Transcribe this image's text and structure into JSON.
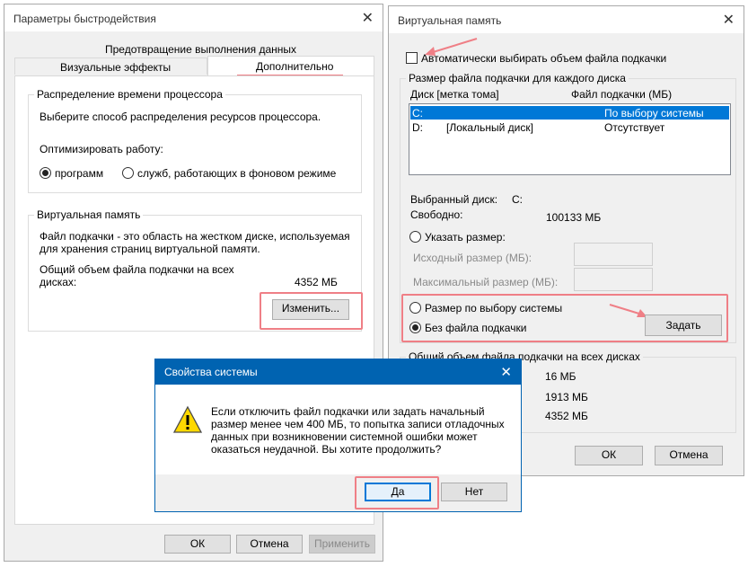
{
  "perf": {
    "title": "Параметры быстродействия",
    "tabs": [
      "Предотвращение выполнения данных",
      "Визуальные эффекты",
      "Дополнительно"
    ],
    "cpu": {
      "group": "Распределение времени процессора",
      "desc": "Выберите способ распределения ресурсов процессора.",
      "optimize": "Оптимизировать работу:",
      "opt_programs": "программ",
      "opt_services": "служб, работающих в фоновом режиме"
    },
    "vm": {
      "group": "Виртуальная память",
      "desc1": "Файл подкачки - это область на жестком диске, используемая",
      "desc2": "для хранения страниц виртуальной памяти.",
      "total1": "Общий объем файла подкачки на всех",
      "total2": "дисках:",
      "total_value": "4352 МБ",
      "change": "Изменить..."
    },
    "buttons": {
      "ok": "ОК",
      "cancel": "Отмена",
      "apply": "Применить"
    }
  },
  "virt": {
    "title": "Виртуальная память",
    "auto": "Автоматически выбирать объем файла подкачки",
    "per_disk": "Размер файла подкачки для каждого диска",
    "col_disk": "Диск [метка тома]",
    "col_file": "Файл подкачки (МБ)",
    "rows": [
      {
        "disk": "C:",
        "label": "",
        "file": "По выбору системы"
      },
      {
        "disk": "D:",
        "label": "[Локальный диск]",
        "file": "Отсутствует"
      }
    ],
    "selected_label": "Выбранный диск:",
    "selected_value": "C:",
    "free_label": "Свободно:",
    "free_value": "100133 МБ",
    "custom": "Указать размер:",
    "initial": "Исходный размер (МБ):",
    "max": "Максимальный размер (МБ):",
    "system": "Размер по выбору системы",
    "none": "Без файла подкачки",
    "set": "Задать",
    "total_group": "Общий объем файла подкачки на всех дисках",
    "total_values": [
      "16 МБ",
      "1913 МБ",
      "4352 МБ"
    ],
    "buttons": {
      "ok": "ОК",
      "cancel": "Отмена"
    }
  },
  "dialog": {
    "title": "Свойства системы",
    "lines": [
      "Если отключить файл подкачки или задать начальный",
      "размер менее чем 400 МБ, то попытка записи отладочных",
      "данных при возникновении системной ошибки может",
      "оказаться неудачной. Вы хотите продолжить?"
    ],
    "yes": "Да",
    "no": "Нет"
  },
  "colors": {
    "annotation": "#ef7f86",
    "selection": "#0078d7",
    "warning": "#ffd800"
  }
}
